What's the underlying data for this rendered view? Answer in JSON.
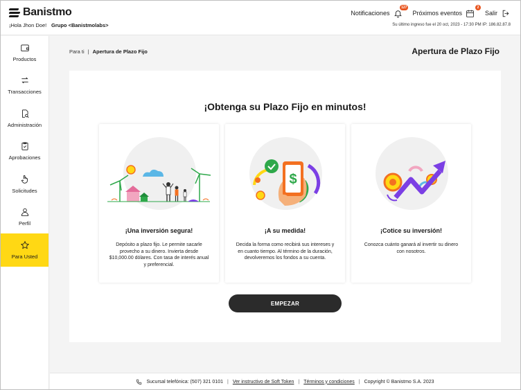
{
  "header": {
    "brand": "Banistmo",
    "greeting": "¡Hola Jhon Doe!",
    "group": "Grupo <Banistmolabs>",
    "notifications_label": "Notificaciones",
    "notifications_count": "127",
    "events_label": "Próximos eventos",
    "events_count": "2",
    "logout_label": "Salir",
    "last_login": "Su último ingreso fue el 20 oct, 2023 - 17:30 PM IP: 186.82.87.8"
  },
  "sidebar": {
    "items": [
      {
        "label": "Productos",
        "icon": "wallet-icon"
      },
      {
        "label": "Transacciones",
        "icon": "transfer-arrows-icon"
      },
      {
        "label": "Administración",
        "icon": "document-search-icon"
      },
      {
        "label": "Aprobaciones",
        "icon": "clipboard-check-icon"
      },
      {
        "label": "Solicitudes",
        "icon": "hand-pointer-icon"
      },
      {
        "label": "Perfil",
        "icon": "user-icon"
      },
      {
        "label": "Para Usted",
        "icon": "star-icon"
      }
    ],
    "active_color": "#FFD814"
  },
  "breadcrumb": {
    "parent": "Para ti",
    "separator": "|",
    "current": "Apertura de Plazo Fijo"
  },
  "page_title": "Apertura de Plazo Fijo",
  "main": {
    "heading": "¡Obtenga su Plazo Fijo en minutos!",
    "cards": [
      {
        "title": "¡Una inversión segura!",
        "description": "Depósito a plazo fijo. Le permite sacarle provecho a su dinero. Invierta desde $10,000.00 dólares. Con tasa de interés anual y preferencial."
      },
      {
        "title": "¡A su medida!",
        "description": "Decida la forma como recibirá sus intereses y en cuanto tiempo. Al término de la duración, devolveremos los fondos a su cuenta."
      },
      {
        "title": "¡Cotice su inversión!",
        "description": "Conozca cuánto ganará al invertir su dinero con nosotros."
      }
    ],
    "cta_label": "EMPEZAR"
  },
  "footer": {
    "phone": "Sucursal telefónica: (507) 321 0101",
    "soft_token_link": "Ver instructivo de Soft Token",
    "terms_link": "Términos y condiciones",
    "copyright": "Copyright © Banistmo S.A. 2023",
    "separator": "|"
  },
  "colors": {
    "accent_yellow": "#FFD814",
    "badge_orange": "#E8541E",
    "button_dark": "#2B2B2B",
    "purple": "#7B3FE4",
    "green": "#2EA84A",
    "orange": "#F37021"
  }
}
